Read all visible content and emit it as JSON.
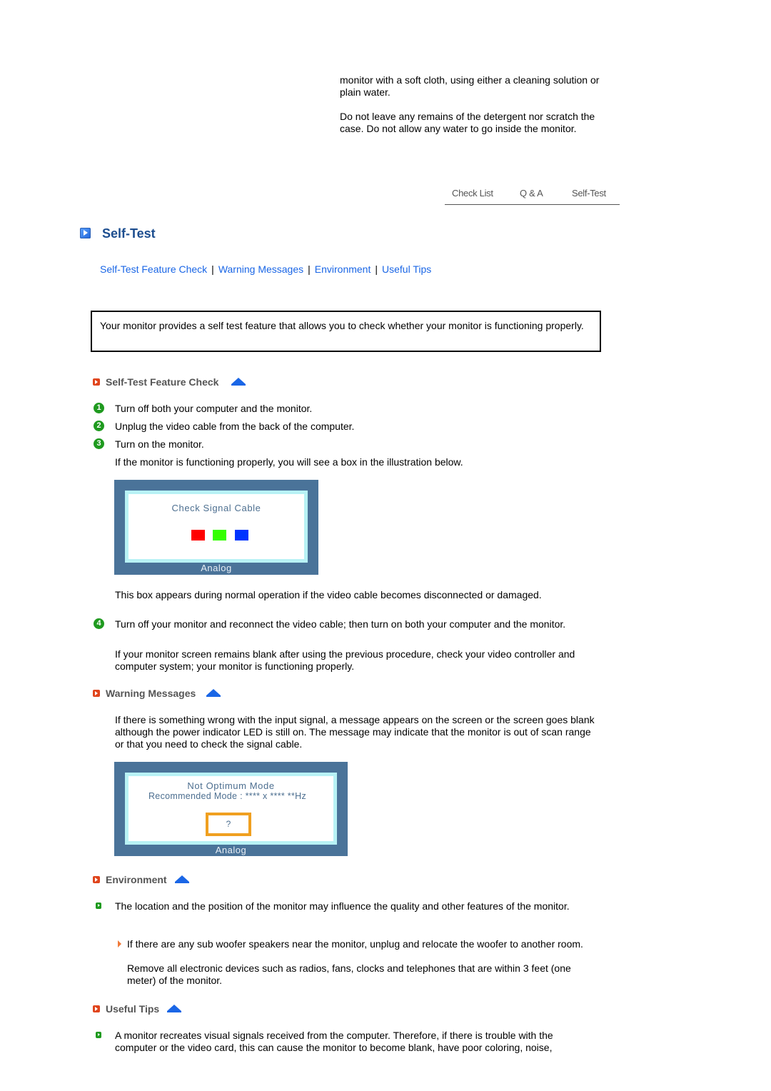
{
  "continuation": {
    "paragraphs": [
      "monitor with a soft cloth, using either a cleaning solution or plain water.",
      "Do not leave any remains of the detergent nor scratch the case. Do not allow any water to go inside the monitor."
    ]
  },
  "top_nav": {
    "items": [
      "Check List",
      "Q & A",
      "Self-Test"
    ]
  },
  "page": {
    "title": "Self-Test",
    "title_icon": "play-square-icon"
  },
  "sub_nav": {
    "links": [
      "Self-Test Feature Check",
      "Warning Messages",
      "Environment",
      "Useful Tips"
    ],
    "separator": "|"
  },
  "intro": "Your monitor provides a self test feature that allows you to check whether your monitor is functioning properly.",
  "sections": {
    "feature_check": {
      "heading": "Self-Test Feature Check",
      "steps": [
        {
          "num": "1",
          "text": "Turn off both your computer and the monitor."
        },
        {
          "num": "2",
          "text": "Unplug the video cable from the back of the computer."
        },
        {
          "num": "3",
          "text": "Turn on the monitor."
        }
      ],
      "step3_note": "If the monitor is functioning properly, you will see a box in the illustration below.",
      "illustration": {
        "message": "Check Signal Cable",
        "footer": "Analog",
        "colors": [
          "#ff0000",
          "#33ff00",
          "#0033ff"
        ]
      },
      "illustration_caption": "This box appears during normal operation if the video cable becomes disconnected or damaged.",
      "step4": {
        "num": "4",
        "text": "Turn off your monitor and reconnect the video cable; then turn on both your computer and the monitor."
      },
      "step4_note": "If your monitor screen remains blank after using the previous procedure, check your video controller and computer system; your monitor is functioning properly."
    },
    "warning_messages": {
      "heading": "Warning Messages",
      "text": "If there is something wrong with the input signal, a message appears on the screen or the screen goes blank although the power indicator LED is still on. The message may indicate that the monitor is out of scan range or that you need to check the signal cable.",
      "illustration": {
        "line1": "Not Optimum Mode",
        "line2": "Recommended Mode : **** x ****  **Hz",
        "button": "?",
        "footer": "Analog"
      }
    },
    "environment": {
      "heading": "Environment",
      "text": "The location and the position of the monitor may influence the quality and other features of the monitor.",
      "sub_text_1": "If there are any sub woofer speakers near the monitor, unplug and relocate the woofer to another room.",
      "sub_text_2": "Remove all electronic devices such as radios, fans, clocks and telephones that are within 3 feet (one meter) of the monitor."
    },
    "useful_tips": {
      "heading": "Useful Tips",
      "text": "A monitor recreates visual signals received from the computer. Therefore, if there is trouble with the computer or the video card, this can cause the monitor to become blank, have poor coloring, noise,"
    }
  }
}
